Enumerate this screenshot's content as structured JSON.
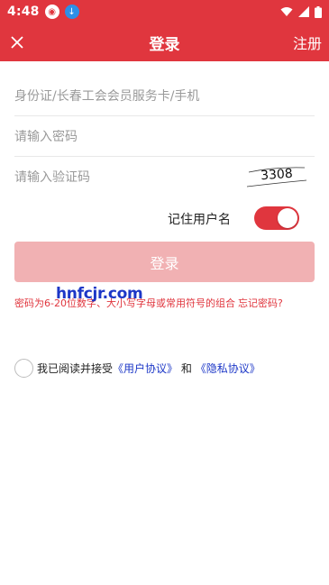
{
  "status_bar": {
    "time": "4:48"
  },
  "header": {
    "title": "登录",
    "register_label": "注册"
  },
  "form": {
    "id_placeholder": "身份证/长春工会会员服务卡/手机",
    "password_placeholder": "请输入密码",
    "captcha_placeholder": "请输入验证码",
    "captcha_code": "3308",
    "remember_label": "记住用户名",
    "remember_on": true,
    "login_button": "登录",
    "hint": "密码为6-20位数字、大小写字母或常用符号的组合",
    "forgot_password": "忘记密码?"
  },
  "watermark": "hnfcjr.com",
  "agreement": {
    "prefix": "我已阅读并接受",
    "user_agreement": "《用户协议》",
    "and": "和",
    "privacy_agreement": "《隐私协议》"
  },
  "colors": {
    "brand_red": "#e0363e",
    "button_disabled": "#f1b1b3",
    "link_blue": "#1c37c7"
  }
}
